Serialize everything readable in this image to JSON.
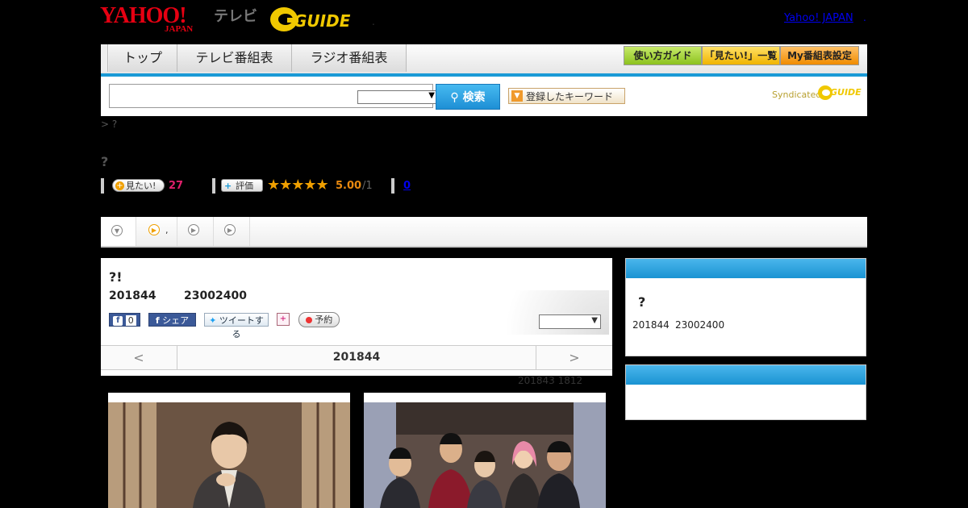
{
  "header": {
    "yahoo_logo": "YAHOO!",
    "yahoo_japan_sub": "JAPAN",
    "tv_label": "テレビ",
    "gguide_logo": "GUIDE",
    "yahoo_japan_link": "Yahoo! JAPAN",
    "dot": "."
  },
  "nav": {
    "tabs": [
      "トップ",
      "テレビ番組表",
      "ラジオ番組表"
    ],
    "guide_buttons": [
      "使い方ガイド",
      "「見たい!」一覧",
      "My番組表設定"
    ]
  },
  "search": {
    "button_label": "検索",
    "keyword_button": "登録したキーワード",
    "syndicated_label": "Syndicated",
    "syndicated_logo": "GUIDE"
  },
  "breadcrumb": "> ?",
  "page_title": "?",
  "stats": {
    "want_label": "見たい!",
    "want_count": "27",
    "rate_label": "評価",
    "stars": "★★★★★",
    "rating": "5.00",
    "rating_suffix": "/1",
    "review_count": "0"
  },
  "tabs_strip": {
    "item2_text": ","
  },
  "program": {
    "title": "?!",
    "date": "201844",
    "time": "23002400",
    "fb_like_count": "0",
    "fb_share": "シェア",
    "tweet": "ツイートする",
    "reserve": "予約",
    "nav_prev": "<",
    "nav_date": "201844",
    "nav_next": ">",
    "updated": "201843  1812"
  },
  "side": {
    "title": "?",
    "date": "201844",
    "time": "23002400"
  },
  "colors": {
    "accent_blue": "#1a9ad6",
    "yahoo_red": "#e60012",
    "want_pink": "#e0206b",
    "rating_orange": "#e8890f"
  }
}
